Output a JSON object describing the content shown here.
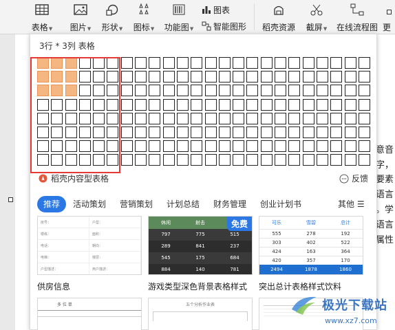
{
  "ribbon": {
    "items": [
      {
        "label": "表格",
        "icon": "table-icon"
      },
      {
        "label": "图片",
        "icon": "picture-icon"
      },
      {
        "label": "形状",
        "icon": "shapes-icon"
      },
      {
        "label": "图标",
        "icon": "icons-icon"
      },
      {
        "label": "功能图",
        "icon": "barcode-icon"
      },
      {
        "label": "稻壳资源",
        "icon": "resources-icon"
      },
      {
        "label": "截屏",
        "icon": "scissors-icon"
      },
      {
        "label": "在线流程图",
        "icon": "flowchart-icon"
      },
      {
        "label": "更",
        "icon": ""
      }
    ],
    "chart_label": "图表",
    "smart_graphic_label": "智能图形"
  },
  "panel": {
    "grid_title": "3行 * 3列 表格",
    "grid": {
      "rows": 8,
      "cols": 24,
      "selected_rows": 3,
      "selected_cols": 3
    },
    "ai_table_label": "稻壳内容型表格",
    "feedback_label": "反馈",
    "tabs": [
      "推荐",
      "活动策划",
      "营销策划",
      "计划总结",
      "财务管理",
      "创业计划书"
    ],
    "more_label": "其他",
    "templates": [
      {
        "name": "供房信息"
      },
      {
        "name": "游戏类型深色背景表格样式"
      },
      {
        "name": "突出总计表格样式饮料"
      }
    ],
    "free_badge": "免费",
    "card1_fields": [
      [
        "房号：",
        "户型："
      ],
      [
        "楼栋：",
        "面积："
      ],
      [
        "电话：",
        "朝向："
      ],
      [
        "电梯：",
        "楼层："
      ],
      [
        "户型描述：",
        "用户描述："
      ],
      [
        "地址：",
        "价格："
      ]
    ],
    "card2": {
      "headers": [
        "休闲",
        "射击",
        ""
      ],
      "rows": [
        [
          "797",
          "775",
          "515"
        ],
        [
          "289",
          "841",
          "237"
        ],
        [
          "545",
          "175",
          "684"
        ],
        [
          "884",
          "140",
          "781"
        ]
      ]
    },
    "card3": {
      "headers": [
        "可乐",
        "雪碧",
        "总计"
      ],
      "rows": [
        [
          "555",
          "278",
          "192"
        ],
        [
          "303",
          "402",
          "522"
        ],
        [
          "424",
          "163",
          "364"
        ],
        [
          "420",
          "357",
          "170"
        ]
      ],
      "total": [
        "2494",
        "1878",
        "1860"
      ]
    },
    "card4_title": "多 位 单",
    "card5_title": "五个分析作业表"
  },
  "document": {
    "right_text": [
      "意音",
      "字，",
      "要素",
      "语言",
      "。学",
      "语言",
      "属性"
    ]
  },
  "watermark": {
    "text": "极光下载站",
    "url": "www.xz7.com"
  },
  "colors": {
    "selected_cell": "#f5b782",
    "accent": "#2b78e4",
    "highlight_box": "#e53935"
  }
}
